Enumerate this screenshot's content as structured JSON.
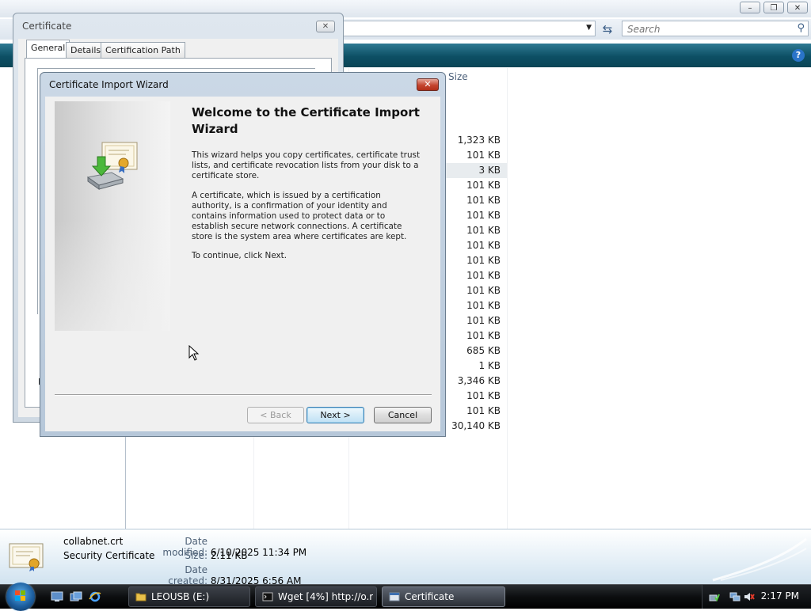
{
  "explorer": {
    "search_placeholder": "Search",
    "column_size": "Size",
    "sizes": [
      "1,323 KB",
      "101 KB",
      "3 KB",
      "101 KB",
      "101 KB",
      "101 KB",
      "101 KB",
      "101 KB",
      "101 KB",
      "101 KB",
      "101 KB",
      "101 KB",
      "101 KB",
      "101 KB",
      "685 KB",
      "1 KB",
      "3,346 KB",
      "101 KB",
      "101 KB",
      "30,140 KB"
    ],
    "selected_size_index": 2,
    "details": {
      "file_name": "collabnet.crt",
      "file_type": "Security Certificate",
      "date_modified_label": "Date modified:",
      "date_modified": "6/10/2025 11:34 PM",
      "size_label": "Size:",
      "size": "2.11 KB",
      "date_created_label": "Date created:",
      "date_created": "8/31/2025 6:56 AM"
    }
  },
  "certificate_dialog": {
    "title": "Certificate",
    "tabs": [
      "General",
      "Details",
      "Certification Path"
    ],
    "active_tab": "General",
    "partial_label": "Le"
  },
  "wizard": {
    "title": "Certificate Import Wizard",
    "heading": "Welcome to the Certificate Import Wizard",
    "para1": "This wizard helps you copy certificates, certificate trust lists, and certificate revocation lists from your disk to a certificate store.",
    "para2": "A certificate, which is issued by a certification authority, is a confirmation of your identity and contains information used to protect data or to establish secure network connections. A certificate store is the system area where certificates are kept.",
    "para3": "To continue, click Next.",
    "back_label": "< Back",
    "next_label": "Next >",
    "cancel_label": "Cancel"
  },
  "taskbar": {
    "tasks": [
      {
        "label": "LEOUSB (E:)",
        "icon": "folder-icon"
      },
      {
        "label": "Wget [4%] http://o.r...",
        "icon": "console-icon"
      },
      {
        "label": "Certificate",
        "icon": "certificate-icon"
      }
    ],
    "active_task": "Certificate",
    "clock": "2:17 PM"
  },
  "colors": {
    "toolbar": "#0d4f64",
    "wizard_frame": "#b6c7d9",
    "close_red": "#c4452f",
    "taskbar": "#0c0e10"
  }
}
